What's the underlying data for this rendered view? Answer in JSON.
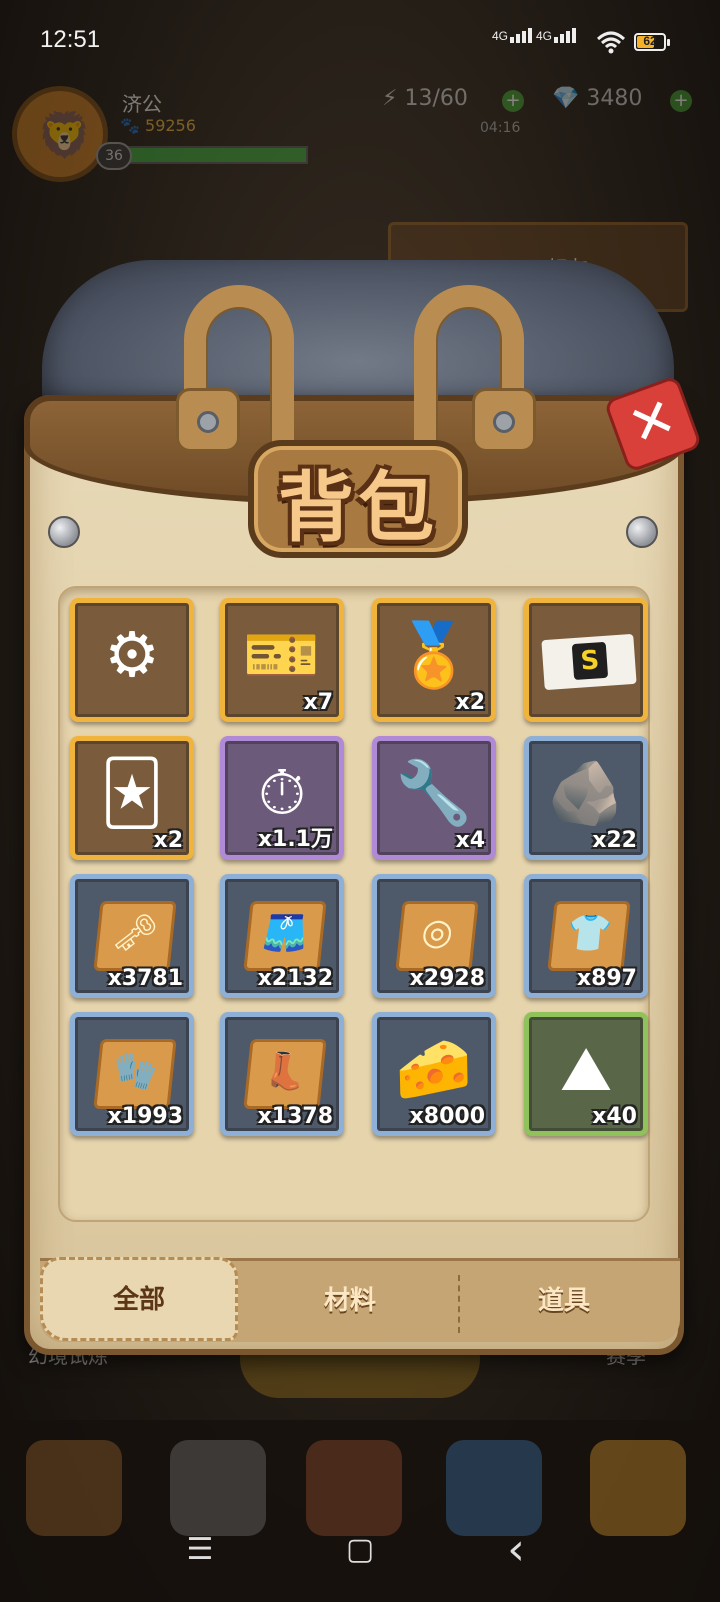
{
  "status": {
    "time": "12:51",
    "signal1": "4G",
    "signal2": "4G",
    "battery": "62"
  },
  "hud": {
    "player_name": "济公",
    "paw_count": "59256",
    "level": "36",
    "energy": "13/60",
    "energy_timer": "04:16",
    "gems": "3480"
  },
  "background": {
    "friends_label": "好友",
    "trial_label": "幻境试炼",
    "season_label": "赛季"
  },
  "bag": {
    "title": "背包",
    "close_symbol": "✕",
    "items": [
      {
        "icon": "motor-icon",
        "glyph": "⚙",
        "qty": "",
        "rarity": "gold"
      },
      {
        "icon": "ticket-icon",
        "glyph": "🎫",
        "qty": "x7",
        "rarity": "gold"
      },
      {
        "icon": "medal-icon",
        "glyph": "🏅",
        "qty": "x2",
        "rarity": "gold"
      },
      {
        "icon": "s-badge-icon",
        "glyph": "S",
        "qty": "",
        "rarity": "gold"
      },
      {
        "icon": "card-icon",
        "glyph": "🃏",
        "qty": "x2",
        "rarity": "gold"
      },
      {
        "icon": "stopwatch-icon",
        "glyph": "⏱",
        "qty": "x1.1万",
        "rarity": "purple"
      },
      {
        "icon": "wrench-icon",
        "glyph": "🔧",
        "qty": "x4",
        "rarity": "purple"
      },
      {
        "icon": "ore-icon",
        "glyph": "🪨",
        "qty": "x22",
        "rarity": "blue"
      },
      {
        "icon": "key-scroll-icon",
        "glyph": "🗝",
        "qty": "x3781",
        "rarity": "blue"
      },
      {
        "icon": "pants-scroll-icon",
        "glyph": "🩳",
        "qty": "x2132",
        "rarity": "blue"
      },
      {
        "icon": "ring-scroll-icon",
        "glyph": "◎",
        "qty": "x2928",
        "rarity": "blue"
      },
      {
        "icon": "shirt-scroll-icon",
        "glyph": "👕",
        "qty": "x897",
        "rarity": "blue"
      },
      {
        "icon": "glove-scroll-icon",
        "glyph": "🧤",
        "qty": "x1993",
        "rarity": "blue"
      },
      {
        "icon": "boot-scroll-icon",
        "glyph": "👢",
        "qty": "x1378",
        "rarity": "blue"
      },
      {
        "icon": "cheese-icon",
        "glyph": "🧀",
        "qty": "x8000",
        "rarity": "blue"
      },
      {
        "icon": "powder-icon",
        "glyph": "⛰",
        "qty": "x40",
        "rarity": "green"
      }
    ],
    "tabs": [
      {
        "label": "全部",
        "active": true
      },
      {
        "label": "材料",
        "active": false
      },
      {
        "label": "道具",
        "active": false
      }
    ]
  },
  "nav": {
    "menu": "☰",
    "home": "▢",
    "back": "‹"
  }
}
